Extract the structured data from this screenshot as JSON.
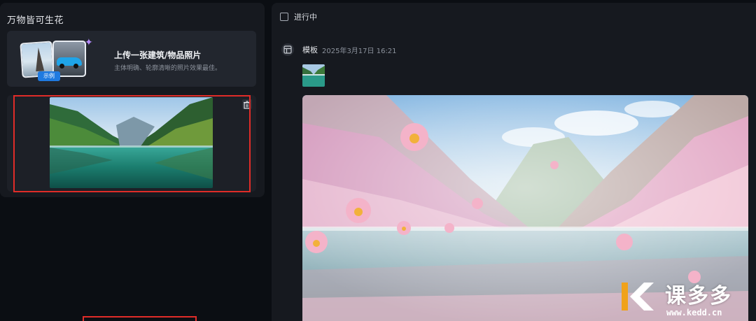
{
  "left": {
    "title": "万物皆可生花",
    "upload": {
      "title": "上传一张建筑/物品照片",
      "subtitle": "主体明确、轮廓清晰的照片效果最佳。",
      "example_badge": "示例"
    },
    "image_slot": {
      "delete_icon": "trash-icon"
    }
  },
  "right": {
    "status": "进行中",
    "template": {
      "label": "模板",
      "time": "2025年3月17日 16:21",
      "icon": "template-layout-icon"
    }
  },
  "watermark": {
    "brand": "课多多",
    "url": "www.kedd.cn"
  },
  "colors": {
    "accent_blue": "#1f7ae0",
    "highlight_red": "#e02c28",
    "panel_bg": "#16191f",
    "page_bg": "#0b0e13"
  }
}
